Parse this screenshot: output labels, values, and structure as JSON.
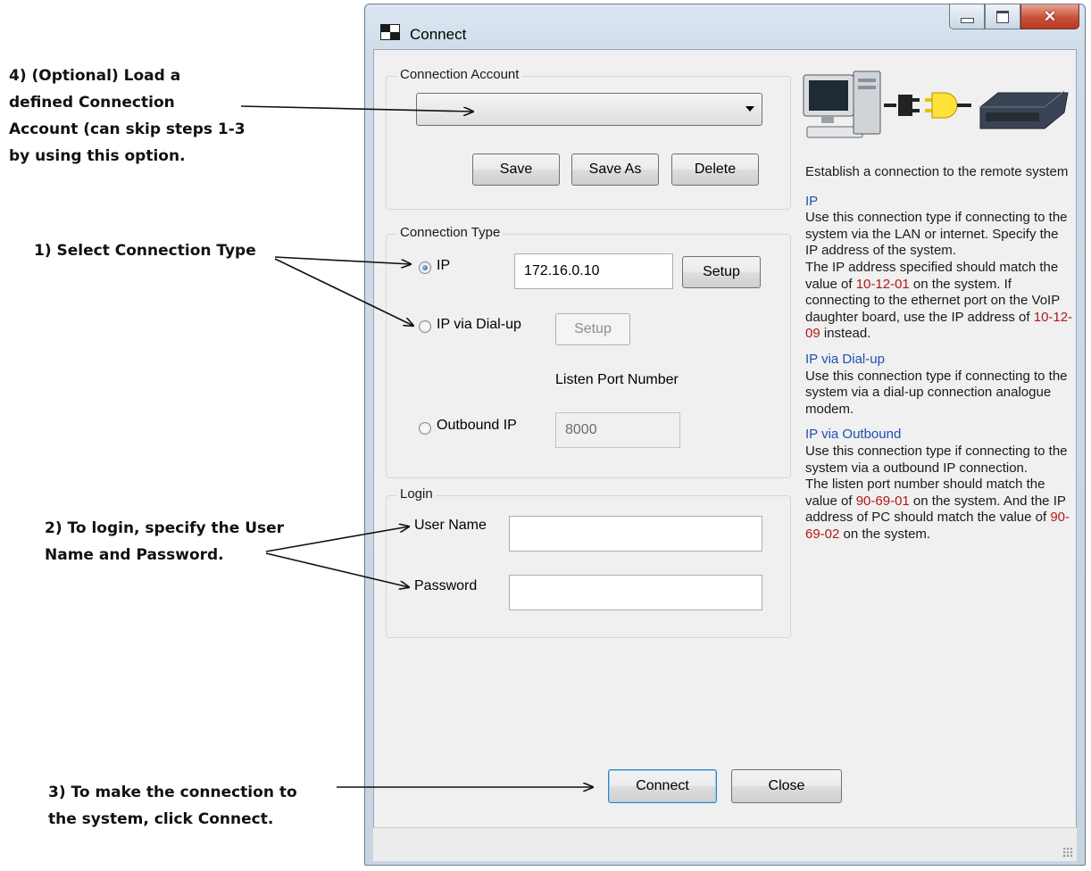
{
  "annotations": {
    "step4_lines": [
      "4) (Optional) Load a",
      "defined Connection",
      "Account (can skip steps 1-3",
      "by using this option."
    ],
    "step1": "1) Select Connection Type",
    "step2_lines": [
      "2) To login, specify the User",
      "Name and Password."
    ],
    "step3_lines": [
      "3) To make the connection to",
      "the system, click Connect."
    ]
  },
  "window": {
    "title": "Connect",
    "caption_buttons": [
      "minimize-icon",
      "maximize-icon",
      "close-icon"
    ]
  },
  "connection_account": {
    "group_label": "Connection Account",
    "selected_value": "",
    "buttons": {
      "save": "Save",
      "save_as": "Save As",
      "delete": "Delete"
    }
  },
  "connection_type": {
    "group_label": "Connection Type",
    "options": [
      {
        "label": "IP",
        "checked": true
      },
      {
        "label": "IP via Dial-up",
        "checked": false
      },
      {
        "label": "Outbound IP",
        "checked": false
      }
    ],
    "ip_address": "172.16.0.10",
    "setup_label": "Setup",
    "dialup_setup_label": "Setup",
    "listen_port_label": "Listen Port Number",
    "listen_port_value": "8000"
  },
  "login": {
    "group_label": "Login",
    "user_name_label": "User Name",
    "user_name_value": "",
    "password_label": "Password",
    "password_value": ""
  },
  "actions": {
    "connect": "Connect",
    "close": "Close"
  },
  "help": {
    "intro": "Establish a connection to the remote system",
    "ip_heading": "IP",
    "ip_text_1": "Use this connection type if connecting to the system via the LAN or internet. Specify the IP address of the system.",
    "ip_text_2a": "The IP address specified should match the value of ",
    "ip_code_1": "10-12-01",
    "ip_text_2b": " on the system. If connecting to the ethernet port on the VoIP daughter board, use the IP address of ",
    "ip_code_2": "10-12-09",
    "ip_text_2c": " instead.",
    "dialup_heading": "IP via Dial-up",
    "dialup_text": "Use this connection type if connecting to the system via a dial-up connection analogue modem.",
    "outbound_heading": "IP via Outbound",
    "outbound_text_1": "Use this connection type if connecting to the system via a outbound IP connection.",
    "outbound_text_2a": "The listen port number should match the value of ",
    "outbound_code_1": "90-69-01",
    "outbound_text_2b": " on the system. And the IP address of PC should match the value of ",
    "outbound_code_2": "90-69-02",
    "outbound_text_2c": " on the system."
  },
  "colors": {
    "help_heading": "#1f4fb3",
    "help_code": "#b01818",
    "close_button": "#c8503a"
  }
}
